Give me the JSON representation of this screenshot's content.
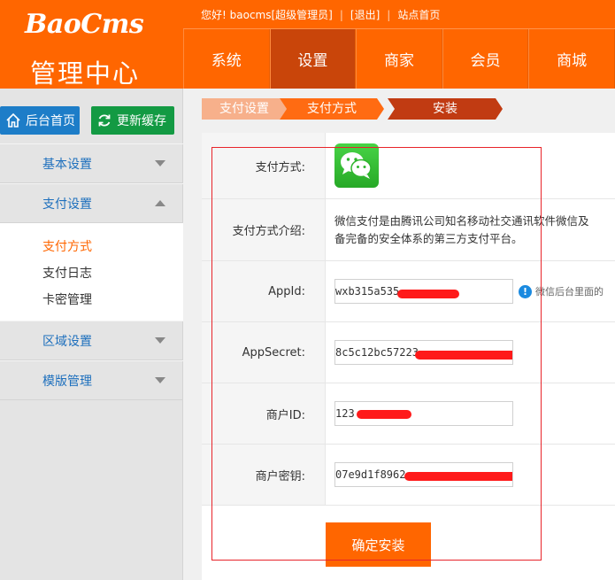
{
  "header": {
    "logo": "BaoCms",
    "logo_sub": "管理中心",
    "greeting": "您好! baocms[超级管理员]",
    "logout": "[退出]",
    "site_home": "站点首页",
    "separator": "|",
    "accent": "#ff6600"
  },
  "nav": {
    "items": [
      "系统",
      "设置",
      "商家",
      "会员",
      "商城"
    ],
    "active": "设置"
  },
  "sidebar": {
    "home_button": "后台首页",
    "refresh_button": "更新缓存",
    "menu": [
      {
        "label": "基本设置",
        "icon": "chevron-down-icon"
      },
      {
        "label": "支付设置",
        "icon": "chevron-up-icon"
      },
      {
        "label": "区域设置",
        "icon": "chevron-down-icon"
      },
      {
        "label": "模版管理",
        "icon": "chevron-down-icon"
      }
    ],
    "submenu": [
      "支付方式",
      "支付日志",
      "卡密管理"
    ],
    "active_sub": "支付方式"
  },
  "steps": [
    "支付设置",
    "支付方式",
    "安装"
  ],
  "form": {
    "rows": [
      {
        "label": "支付方式:",
        "icon": "wechat-icon"
      },
      {
        "label": "支付方式介绍:",
        "text_line1": "微信支付是由腾讯公司知名移动社交通讯软件微信及",
        "text_line2": "备完备的安全体系的第三方支付平台。"
      },
      {
        "label": "AppId:",
        "value": "wxb315a535",
        "hint": "微信后台里面的"
      },
      {
        "label": "AppSecret:",
        "value": "8c5c12bc57223"
      },
      {
        "label": "商户ID:",
        "value": "123"
      },
      {
        "label": "商户密钥:",
        "value": "07e9d1f8962"
      }
    ],
    "submit_label": "确定安装"
  }
}
